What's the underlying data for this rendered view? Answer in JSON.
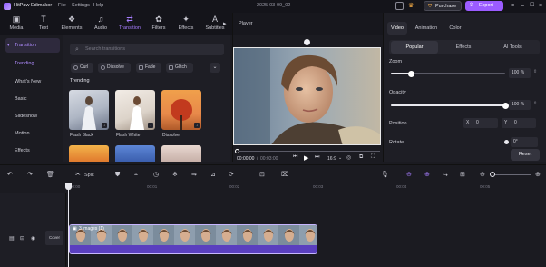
{
  "app": {
    "title": "HitPaw Edimakor",
    "menu": [
      "File",
      "Settings",
      "Help"
    ],
    "project_name": "2025-03-09_02",
    "purchase_label": "Purchase",
    "export_label": "Export"
  },
  "toolbar": {
    "items": [
      {
        "label": "Media",
        "icon": "media-icon"
      },
      {
        "label": "Text",
        "icon": "text-icon"
      },
      {
        "label": "Elements",
        "icon": "elements-icon"
      },
      {
        "label": "Audio",
        "icon": "audio-icon"
      },
      {
        "label": "Transition",
        "icon": "transition-icon"
      },
      {
        "label": "Filters",
        "icon": "filters-icon"
      },
      {
        "label": "Effects",
        "icon": "effects-icon"
      },
      {
        "label": "Subtitles",
        "icon": "subtitles-icon"
      }
    ],
    "active": "Transition"
  },
  "sidebar": {
    "header": "Transition",
    "items": [
      "Trending",
      "What's New",
      "Basic",
      "Slideshow",
      "Motion",
      "Effects"
    ],
    "selected": "Trending"
  },
  "assets": {
    "search_placeholder": "Search transitions",
    "chips": [
      "Curl",
      "Dissolve",
      "Fade",
      "Glitch"
    ],
    "section_title": "Trending",
    "thumbs": [
      {
        "label": "Flash Black"
      },
      {
        "label": "Flash White"
      },
      {
        "label": "Dissolve"
      },
      {
        "label": ""
      },
      {
        "label": ""
      },
      {
        "label": ""
      }
    ]
  },
  "player": {
    "title": "Player",
    "time_current": "00:00:00",
    "time_total": "00:03:00",
    "aspect": "16:9"
  },
  "props": {
    "tabs": [
      "Video",
      "Animation",
      "Color"
    ],
    "active_tab": "Video",
    "subtabs": [
      "Popular",
      "Effects",
      "AI Tools"
    ],
    "active_subtab": "Popular",
    "zoom_label": "Zoom",
    "zoom_value": "100 %",
    "zoom_level": 0.18,
    "opacity_label": "Opacity",
    "opacity_value": "100 %",
    "opacity_level": 1.0,
    "position_label": "Position",
    "pos_x_label": "X",
    "pos_x_value": "0",
    "pos_y_label": "Y",
    "pos_y_value": "0",
    "rotate_label": "Rotate",
    "rotate_value": "0°",
    "reset_label": "Reset"
  },
  "timeline": {
    "split_label": "Split",
    "ruler_marks": [
      "00:00",
      "00:01",
      "00:02",
      "00:03",
      "00:04",
      "00:05"
    ],
    "clip_label": "3 images (1)",
    "cover_label": "Cover"
  },
  "colors": {
    "accent": "#a77dff",
    "export": "#9b5cff",
    "clip_border": "#c6b5ff",
    "clip_bg": "#3b2e73"
  }
}
